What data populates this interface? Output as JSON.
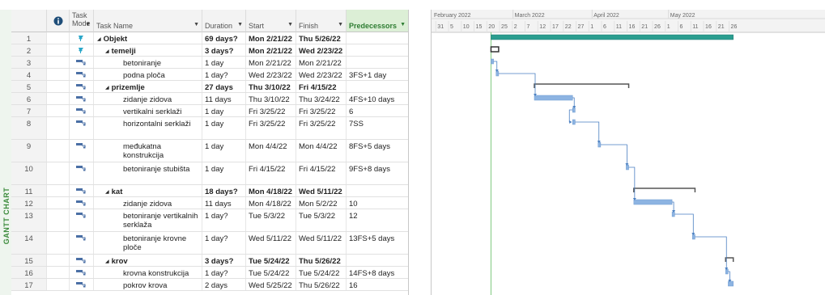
{
  "view_label": "GANTT CHART",
  "columns": {
    "info": "",
    "mode": "Task Mode",
    "name": "Task Name",
    "duration": "Duration",
    "start": "Start",
    "finish": "Finish",
    "predecessors": "Predecessors"
  },
  "tasks": [
    {
      "id": "1",
      "indent": 0,
      "summary": true,
      "mode": "manual",
      "name": "Objekt",
      "duration": "69 days?",
      "start": "Mon 2/21/22",
      "finish": "Thu 5/26/22",
      "pred": ""
    },
    {
      "id": "2",
      "indent": 1,
      "summary": true,
      "mode": "manual",
      "name": "temelji",
      "duration": "3 days?",
      "start": "Mon 2/21/22",
      "finish": "Wed 2/23/22",
      "pred": ""
    },
    {
      "id": "3",
      "indent": 2,
      "summary": false,
      "mode": "auto",
      "name": "betoniranje",
      "duration": "1 day",
      "start": "Mon 2/21/22",
      "finish": "Mon 2/21/22",
      "pred": ""
    },
    {
      "id": "4",
      "indent": 2,
      "summary": false,
      "mode": "auto",
      "name": "podna ploča",
      "duration": "1 day?",
      "start": "Wed 2/23/22",
      "finish": "Wed 2/23/22",
      "pred": "3FS+1 day"
    },
    {
      "id": "5",
      "indent": 1,
      "summary": true,
      "mode": "auto",
      "name": "prizemlje",
      "duration": "27 days",
      "start": "Thu 3/10/22",
      "finish": "Fri 4/15/22",
      "pred": ""
    },
    {
      "id": "6",
      "indent": 2,
      "summary": false,
      "mode": "auto",
      "name": "zidanje zidova",
      "duration": "11 days",
      "start": "Thu 3/10/22",
      "finish": "Thu 3/24/22",
      "pred": "4FS+10 days"
    },
    {
      "id": "7",
      "indent": 2,
      "summary": false,
      "mode": "auto",
      "name": "vertikalni serklaži",
      "duration": "1 day",
      "start": "Fri 3/25/22",
      "finish": "Fri 3/25/22",
      "pred": "6"
    },
    {
      "id": "8",
      "indent": 2,
      "summary": false,
      "mode": "auto",
      "name": "horizontalni serklaži",
      "duration": "1 day",
      "start": "Fri 3/25/22",
      "finish": "Fri 3/25/22",
      "pred": "7SS"
    },
    {
      "id": "9",
      "indent": 2,
      "summary": false,
      "mode": "auto",
      "name": "međukatna konstrukcija",
      "duration": "1 day",
      "start": "Mon 4/4/22",
      "finish": "Mon 4/4/22",
      "pred": "8FS+5 days"
    },
    {
      "id": "10",
      "indent": 2,
      "summary": false,
      "mode": "auto",
      "name": "betoniranje stubišta",
      "duration": "1 day",
      "start": "Fri 4/15/22",
      "finish": "Fri 4/15/22",
      "pred": "9FS+8 days"
    },
    {
      "id": "11",
      "indent": 1,
      "summary": true,
      "mode": "auto",
      "name": "kat",
      "duration": "18 days?",
      "start": "Mon 4/18/22",
      "finish": "Wed 5/11/22",
      "pred": ""
    },
    {
      "id": "12",
      "indent": 2,
      "summary": false,
      "mode": "auto",
      "name": "zidanje zidova",
      "duration": "11 days",
      "start": "Mon 4/18/22",
      "finish": "Mon 5/2/22",
      "pred": "10"
    },
    {
      "id": "13",
      "indent": 2,
      "summary": false,
      "mode": "auto",
      "name": "betoniranje vertikalnih serklaža",
      "duration": "1 day?",
      "start": "Tue 5/3/22",
      "finish": "Tue 5/3/22",
      "pred": "12"
    },
    {
      "id": "14",
      "indent": 2,
      "summary": false,
      "mode": "auto",
      "name": "betoniranje krovne ploče",
      "duration": "1 day?",
      "start": "Wed 5/11/22",
      "finish": "Wed 5/11/22",
      "pred": "13FS+5 days"
    },
    {
      "id": "15",
      "indent": 1,
      "summary": true,
      "mode": "auto",
      "name": "krov",
      "duration": "3 days?",
      "start": "Tue 5/24/22",
      "finish": "Thu 5/26/22",
      "pred": ""
    },
    {
      "id": "16",
      "indent": 2,
      "summary": false,
      "mode": "auto",
      "name": "krovna konstrukcija",
      "duration": "1 day?",
      "start": "Tue 5/24/22",
      "finish": "Tue 5/24/22",
      "pred": "14FS+8 days"
    },
    {
      "id": "17",
      "indent": 2,
      "summary": false,
      "mode": "auto",
      "name": "pokrov krova",
      "duration": "2 days",
      "start": "Wed 5/25/22",
      "finish": "Thu 5/26/22",
      "pred": "16"
    }
  ],
  "timescale": {
    "months": [
      "February 2022",
      "March 2022",
      "April 2022",
      "May 2022"
    ],
    "days": [
      "31",
      "5",
      "10",
      "15",
      "20",
      "25",
      "2",
      "7",
      "12",
      "17",
      "22",
      "27",
      "1",
      "6",
      "11",
      "16",
      "21",
      "26",
      "1",
      "6",
      "11",
      "16",
      "21",
      "26"
    ]
  },
  "colors": {
    "task_bar": "#8db4e2",
    "project_bar": "#2a9d8f",
    "summary_bar": "#555555",
    "link": "#4a7fc1",
    "pred_header": "#dcefd6"
  }
}
